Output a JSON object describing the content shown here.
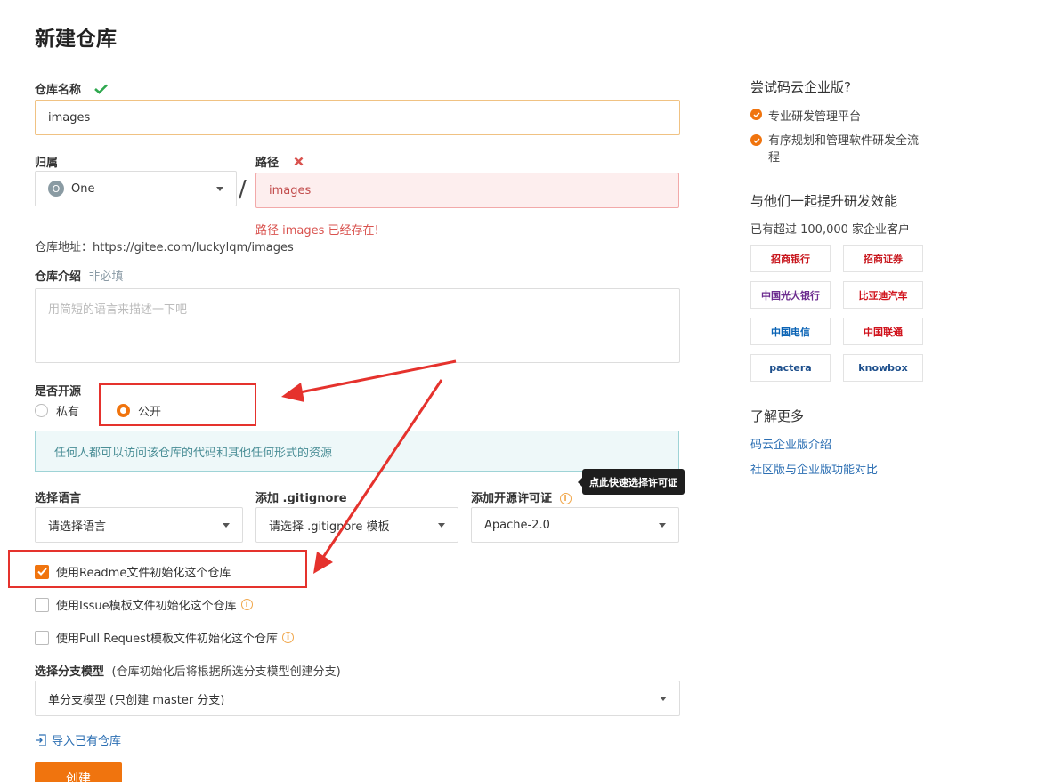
{
  "page": {
    "title": "新建仓库"
  },
  "form": {
    "name_label": "仓库名称",
    "name_value": "images",
    "owner_label": "归属",
    "owner_avatar": "O",
    "owner_value": "One",
    "path_label": "路径",
    "path_value": "images",
    "path_error": "路径 images 已经存在!",
    "address": "仓库地址：https://gitee.com/luckylqm/images",
    "intro_label": "仓库介绍",
    "intro_hint": "非必填",
    "intro_placeholder": "用简短的语言来描述一下吧",
    "open_label": "是否开源",
    "private_label": "私有",
    "public_label": "公开",
    "public_info": "任何人都可以访问该仓库的代码和其他任何形式的资源",
    "language_label": "选择语言",
    "language_value": "请选择语言",
    "gitignore_label": "添加 .gitignore",
    "gitignore_value": "请选择 .gitignore 模板",
    "license_label": "添加开源许可证",
    "license_value": "Apache-2.0",
    "license_tooltip": "点此快速选择许可证",
    "readme_label": "使用Readme文件初始化这个仓库",
    "issue_label": "使用Issue模板文件初始化这个仓库",
    "pr_label": "使用Pull Request模板文件初始化这个仓库",
    "branch_label": "选择分支模型",
    "branch_hint": "(仓库初始化后将根据所选分支模型创建分支)",
    "branch_value": "单分支模型 (只创建 master 分支)",
    "import_link": "导入已有仓库",
    "create_button": "创建"
  },
  "sidebar": {
    "try_title": "尝试码云企业版?",
    "features": [
      "专业研发管理平台",
      "有序规划和管理软件研发全流程"
    ],
    "together_title": "与他们一起提升研发效能",
    "customers_text": "已有超过 100,000 家企业客户",
    "logos": [
      {
        "name": "招商银行",
        "color": "#c8161d"
      },
      {
        "name": "招商证券",
        "color": "#c8161d"
      },
      {
        "name": "中国光大银行",
        "color": "#6c2c8f"
      },
      {
        "name": "比亚迪汽车",
        "color": "#d0121b"
      },
      {
        "name": "中国电信",
        "color": "#0a63b5"
      },
      {
        "name": "中国联通",
        "color": "#d0121b"
      },
      {
        "name": "pactera",
        "color": "#1d4f8c"
      },
      {
        "name": "knowbox",
        "color": "#1d4f8c"
      }
    ],
    "learn_title": "了解更多",
    "links": [
      "码云企业版介绍",
      "社区版与企业版功能对比"
    ]
  },
  "colors": {
    "accent": "#f0740e",
    "error": "#d9534f",
    "annotation": "#e5322d"
  }
}
